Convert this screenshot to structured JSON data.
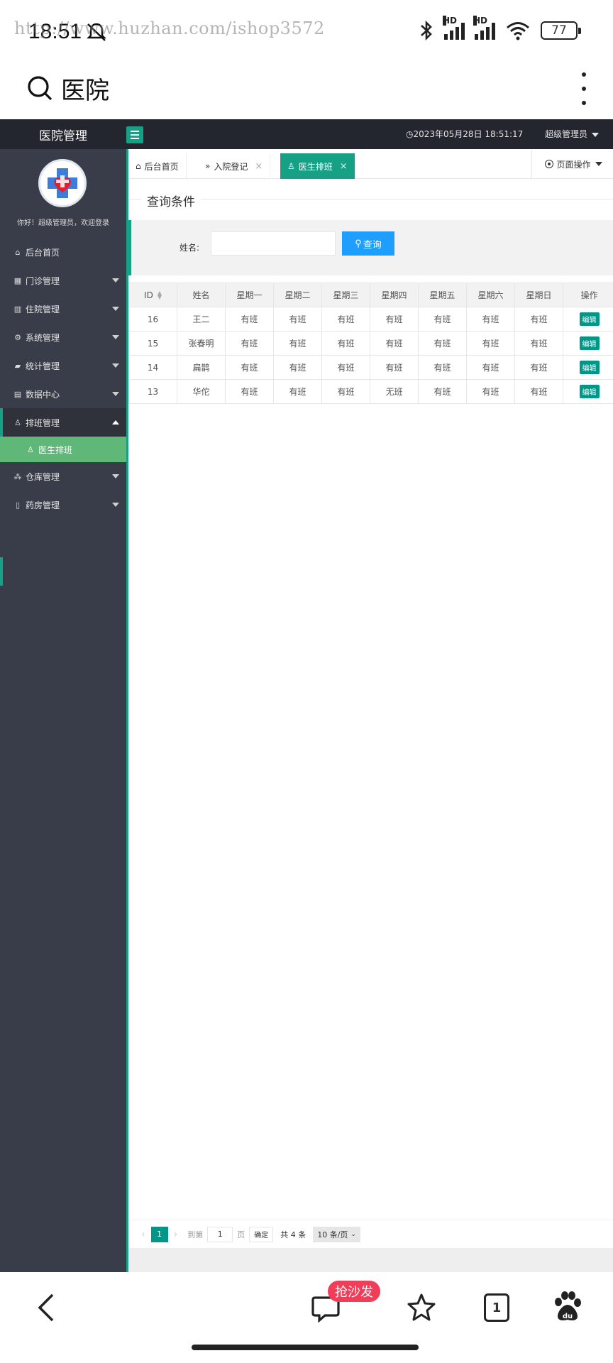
{
  "status_bar": {
    "time": "18:51",
    "watermark": "http://www.huzhan.com/ishop3572",
    "battery": "77",
    "hd1": "HD",
    "hd2": "HD"
  },
  "browser": {
    "title": "医院"
  },
  "header": {
    "logo_title": "医院管理",
    "datetime": "2023年05月28日 18:51:17",
    "admin_label": "超级管理员"
  },
  "sidebar": {
    "welcome": "你好！超级管理员，欢迎登录",
    "items": [
      {
        "label": "后台首页",
        "icon": "home-icon",
        "glyph": "⌂"
      },
      {
        "label": "门诊管理",
        "icon": "clinic-icon",
        "glyph": "▦"
      },
      {
        "label": "住院管理",
        "icon": "building-icon",
        "glyph": "▥"
      },
      {
        "label": "系统管理",
        "icon": "gear-icon",
        "glyph": "⚙"
      },
      {
        "label": "统计管理",
        "icon": "chart-icon",
        "glyph": "▰"
      },
      {
        "label": "数据中心",
        "icon": "database-icon",
        "glyph": "▤"
      },
      {
        "label": "排班管理",
        "icon": "user-icon",
        "glyph": "♙"
      },
      {
        "label": "仓库管理",
        "icon": "warehouse-icon",
        "glyph": "⁂"
      },
      {
        "label": "药房管理",
        "icon": "book-icon",
        "glyph": "▯"
      }
    ],
    "sub_item": {
      "label": "医生排班",
      "icon": "user-icon",
      "glyph": "♙"
    }
  },
  "tabs": [
    {
      "label": "后台首页",
      "icon": "home-icon",
      "glyph": "⌂"
    },
    {
      "label": "入院登记",
      "icon": "double-arrow-icon",
      "glyph": "»"
    },
    {
      "label": "医生排班",
      "icon": "user-icon",
      "glyph": "♙"
    }
  ],
  "page_ops": "页面操作",
  "query": {
    "legend": "查询条件",
    "name_label": "姓名:",
    "name_value": "",
    "search_button": "查询"
  },
  "table": {
    "headers": [
      "ID",
      "姓名",
      "星期一",
      "星期二",
      "星期三",
      "星期四",
      "星期五",
      "星期六",
      "星期日",
      "操作"
    ],
    "rows": [
      [
        "16",
        "王二",
        "有班",
        "有班",
        "有班",
        "有班",
        "有班",
        "有班",
        "有班"
      ],
      [
        "15",
        "张春明",
        "有班",
        "有班",
        "有班",
        "有班",
        "有班",
        "有班",
        "有班"
      ],
      [
        "14",
        "扁鹊",
        "有班",
        "有班",
        "有班",
        "有班",
        "有班",
        "有班",
        "有班"
      ],
      [
        "13",
        "华佗",
        "有班",
        "有班",
        "有班",
        "无班",
        "有班",
        "有班",
        "有班"
      ]
    ],
    "edit_label": "编辑"
  },
  "pager": {
    "current": "1",
    "goto_label": "到第",
    "goto_value": "1",
    "page_label": "页",
    "confirm": "确定",
    "count": "共 4 条",
    "limit": "10 条/页"
  },
  "bottom_nav": {
    "sofa_badge": "抢沙发",
    "tab_count": "1"
  },
  "colors": {
    "accent": "#16a085",
    "sidebar_bg": "#393d49",
    "header_bg": "#23262e",
    "sub_active": "#5fb878",
    "search_btn": "#1e9fff"
  }
}
